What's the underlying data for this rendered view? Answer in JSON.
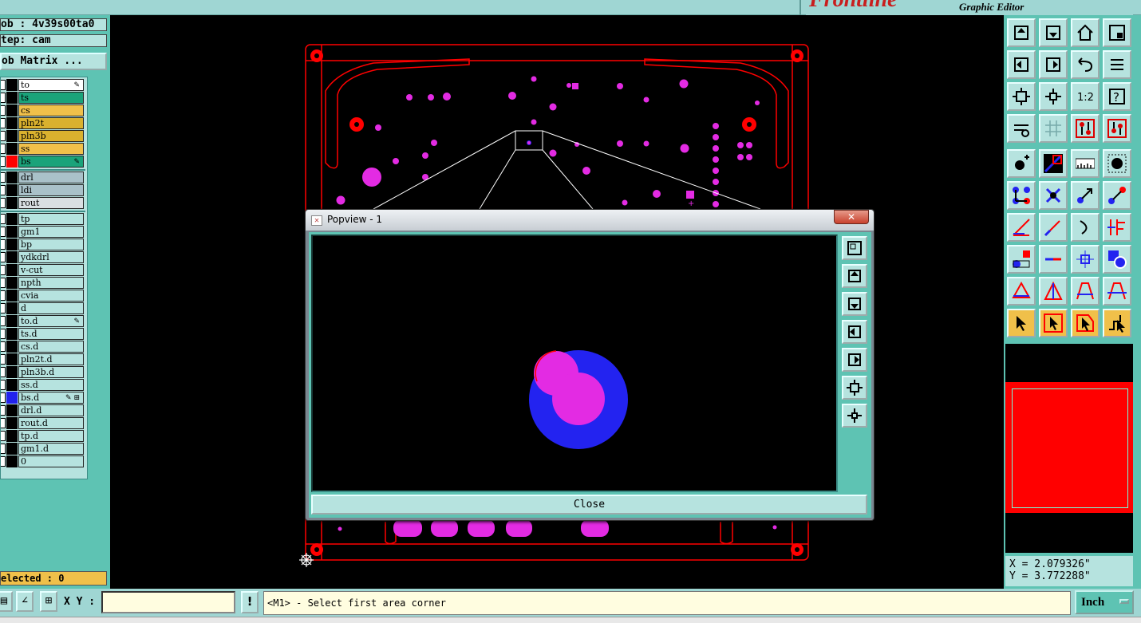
{
  "app": {
    "brand": "Frontline",
    "subtitle": "Graphic Editor"
  },
  "left_panel": {
    "job": "ob : 4v39s00ta0",
    "step": "tep: cam",
    "job_matrix": "ob Matrix ...",
    "selected": "elected : 0",
    "layers": [
      {
        "name": "to",
        "color": "#ffffff",
        "swatch": "#000000",
        "mark": "✎"
      },
      {
        "name": "ts",
        "color": "#1aa37a",
        "swatch": "#000000",
        "mark": ""
      },
      {
        "name": "cs",
        "color": "#f0c04a",
        "swatch": "#000000",
        "mark": ""
      },
      {
        "name": "pln2t",
        "color": "#dab12e",
        "swatch": "#000000",
        "mark": ""
      },
      {
        "name": "pln3b",
        "color": "#dab12e",
        "swatch": "#000000",
        "mark": ""
      },
      {
        "name": "ss",
        "color": "#f0c04a",
        "swatch": "#000000",
        "mark": ""
      },
      {
        "name": "bs",
        "color": "#1aa37a",
        "swatch": "#ff0000",
        "mark": "✎"
      },
      {
        "name": "drl",
        "color": "#a9c1c9",
        "swatch": "#000000",
        "mark": ""
      },
      {
        "name": "ldi",
        "color": "#a9c1c9",
        "swatch": "#000000",
        "mark": ""
      },
      {
        "name": "rout",
        "color": "#d9dfe2",
        "swatch": "#000000",
        "mark": ""
      },
      {
        "name": "tp",
        "color": "#b6e3df",
        "swatch": "#000000",
        "mark": ""
      },
      {
        "name": "gm1",
        "color": "#b6e3df",
        "swatch": "#000000",
        "mark": ""
      },
      {
        "name": "bp",
        "color": "#b6e3df",
        "swatch": "#000000",
        "mark": ""
      },
      {
        "name": "ydkdrl",
        "color": "#b6e3df",
        "swatch": "#000000",
        "mark": ""
      },
      {
        "name": "v-cut",
        "color": "#b6e3df",
        "swatch": "#000000",
        "mark": ""
      },
      {
        "name": "npth",
        "color": "#b6e3df",
        "swatch": "#000000",
        "mark": ""
      },
      {
        "name": "cvia",
        "color": "#b6e3df",
        "swatch": "#000000",
        "mark": ""
      },
      {
        "name": "d",
        "color": "#b6e3df",
        "swatch": "#000000",
        "mark": ""
      },
      {
        "name": "to.d",
        "color": "#b6e3df",
        "swatch": "#000000",
        "mark": "✎"
      },
      {
        "name": "ts.d",
        "color": "#b6e3df",
        "swatch": "#000000",
        "mark": ""
      },
      {
        "name": "cs.d",
        "color": "#b6e3df",
        "swatch": "#000000",
        "mark": ""
      },
      {
        "name": "pln2t.d",
        "color": "#b6e3df",
        "swatch": "#000000",
        "mark": ""
      },
      {
        "name": "pln3b.d",
        "color": "#b6e3df",
        "swatch": "#000000",
        "mark": ""
      },
      {
        "name": "ss.d",
        "color": "#b6e3df",
        "swatch": "#000000",
        "mark": ""
      },
      {
        "name": "bs.d",
        "color": "#b6e3df",
        "swatch": "#2222ee",
        "mark": "✎ ⊞"
      },
      {
        "name": "drl.d",
        "color": "#b6e3df",
        "swatch": "#000000",
        "mark": ""
      },
      {
        "name": "rout.d",
        "color": "#b6e3df",
        "swatch": "#000000",
        "mark": ""
      },
      {
        "name": "tp.d",
        "color": "#b6e3df",
        "swatch": "#000000",
        "mark": ""
      },
      {
        "name": "gm1.d",
        "color": "#b6e3df",
        "swatch": "#000000",
        "mark": ""
      },
      {
        "name": "0",
        "color": "#b6e3df",
        "swatch": "#000000",
        "mark": ""
      }
    ]
  },
  "bottom_bar": {
    "xy_label": "X Y :",
    "xy_value": "",
    "warn_label": "!",
    "status": "<M1> - Select first area corner",
    "units": "Inch"
  },
  "coords": {
    "x": "X = 2.079326\"",
    "y": "Y = 3.772288\""
  },
  "popview": {
    "title": "Popview - 1",
    "close_x": "✕",
    "close_label": "Close"
  },
  "colors": {
    "board_outline": "#ff0000",
    "pad": "#e32be3",
    "layer_bs": "#2323f0",
    "panel_teal": "#5ec3b3",
    "panel_light": "#b6e3df",
    "selected_yellow": "#f0c04a"
  }
}
